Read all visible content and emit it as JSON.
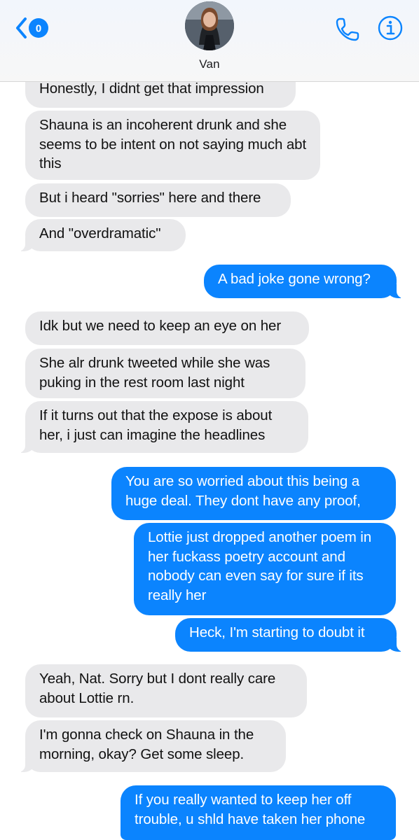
{
  "header": {
    "contact_name": "Van",
    "back_badge_count": "0",
    "accent_color": "#0b84fe"
  },
  "icons": {
    "back": "chevron-left-icon",
    "call": "phone-icon",
    "info": "info-icon"
  },
  "colors": {
    "incoming_bubble": "#e9e9eb",
    "outgoing_bubble": "#0b84fe"
  },
  "messages": [
    {
      "from": "them",
      "text": "Honestly, I didnt get that impression"
    },
    {
      "from": "them",
      "text": "Shauna is an incoherent drunk and she seems to be intent on not saying much abt this"
    },
    {
      "from": "them",
      "text": "But i heard \"sorries\" here and there"
    },
    {
      "from": "them",
      "text": "And \"overdramatic\""
    },
    {
      "from": "me",
      "text": "A bad joke gone wrong?"
    },
    {
      "from": "them",
      "text": "Idk but we need to keep an eye on her"
    },
    {
      "from": "them",
      "text": "She alr drunk tweeted while she was puking in the rest room last night"
    },
    {
      "from": "them",
      "text": "If it turns out that the expose is about her, i just can imagine the headlines"
    },
    {
      "from": "me",
      "text": "You are so worried about this being a huge deal. They dont have any proof,"
    },
    {
      "from": "me",
      "text": "Lottie just dropped another poem in her fuckass poetry account and nobody can even say for sure if its really her"
    },
    {
      "from": "me",
      "text": "Heck, I'm starting to doubt it"
    },
    {
      "from": "them",
      "text": "Yeah, Nat. Sorry but I dont really care about Lottie rn."
    },
    {
      "from": "them",
      "text": "I'm gonna check on Shauna in the morning, okay? Get some sleep."
    },
    {
      "from": "me",
      "text": "If you really wanted to keep her off trouble, u shld have taken her phone"
    }
  ]
}
